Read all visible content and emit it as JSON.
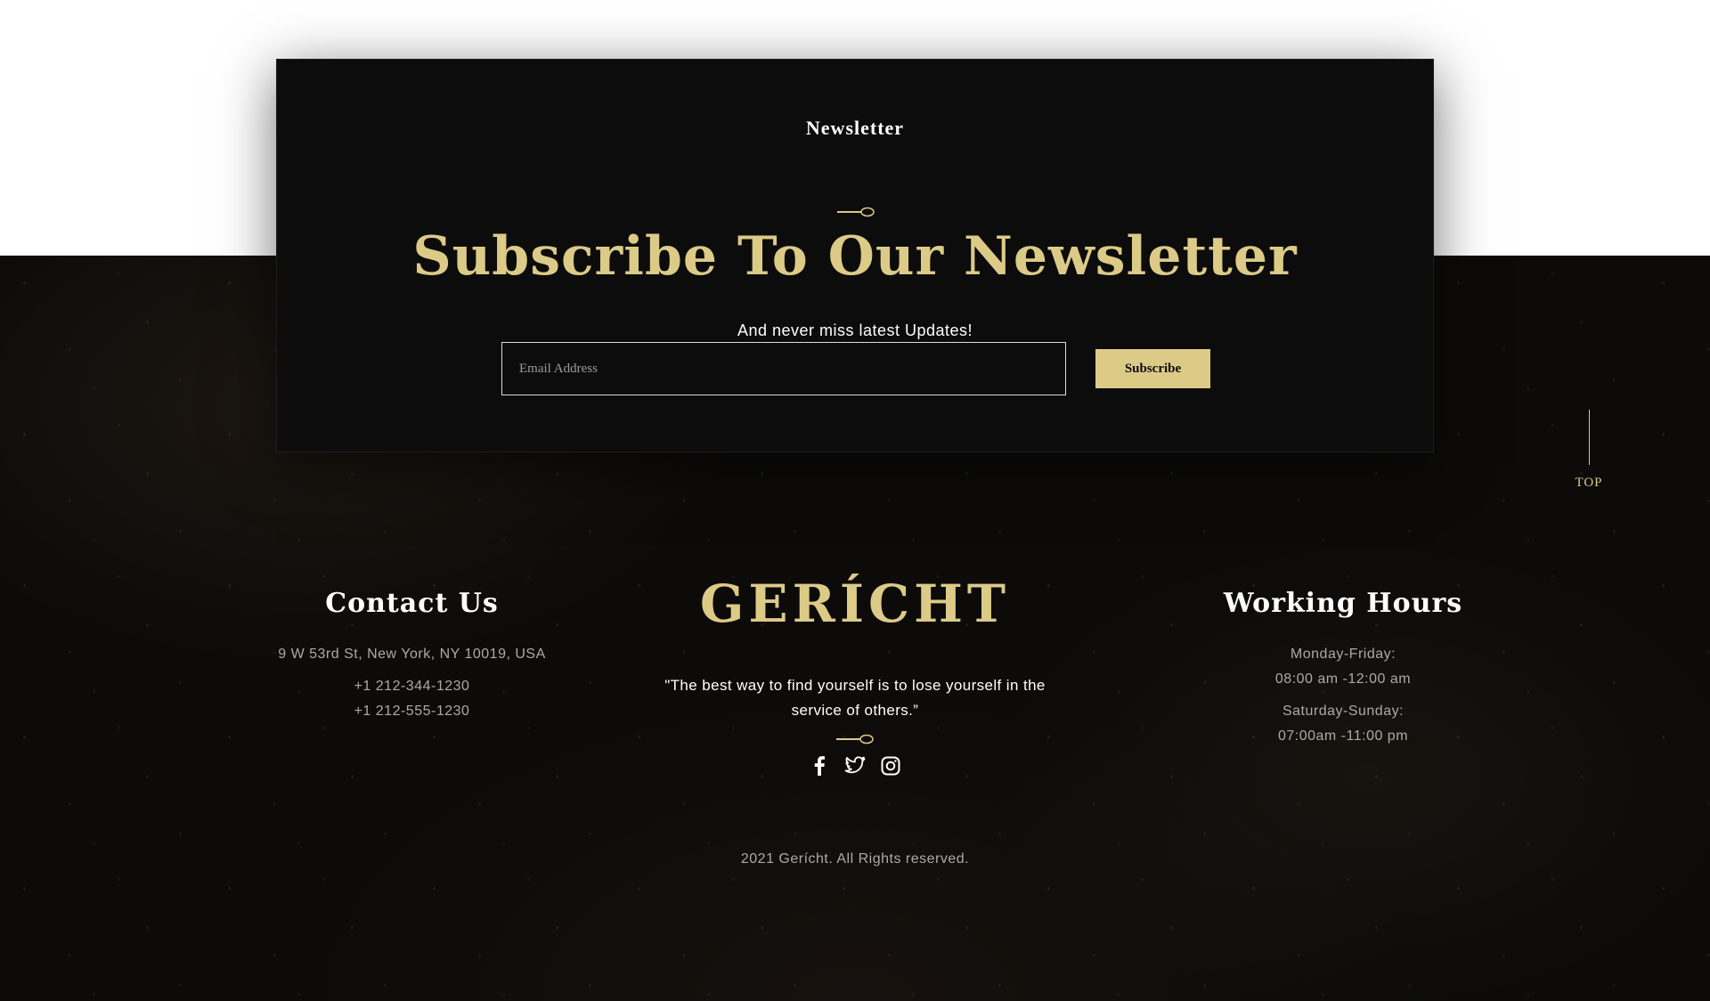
{
  "newsletter": {
    "subtitle": "Newsletter",
    "title": "Subscribe To Our Newsletter",
    "text": "And never miss latest Updates!",
    "email_placeholder": "Email Address",
    "subscribe_label": "Subscribe"
  },
  "top_link": {
    "label": "TOP"
  },
  "contact": {
    "heading": "Contact Us",
    "address": "9 W 53rd St, New York, NY 10019, USA",
    "phone_1": "+1 212-344-1230",
    "phone_2": "+1 212-555-1230"
  },
  "brand": {
    "logo": "GERÍCHT",
    "quote": "\"The best way to find yourself is to lose yourself in the service of others.”",
    "social_icons": [
      "facebook-icon",
      "twitter-icon",
      "instagram-icon"
    ]
  },
  "hours": {
    "heading": "Working Hours",
    "weekday_label": "Monday-Friday:",
    "weekday_time": "08:00 am -12:00 am",
    "weekend_label": "Saturday-Sunday:",
    "weekend_time": "07:00am -11:00 pm"
  },
  "footer": {
    "copyright": "2021 Gerícht. All Rights reserved."
  },
  "colors": {
    "accent_gold": "#dcca87",
    "background_dark": "#0c0c0c",
    "text_white": "#ffffff",
    "text_grey": "#aaaaaa"
  }
}
